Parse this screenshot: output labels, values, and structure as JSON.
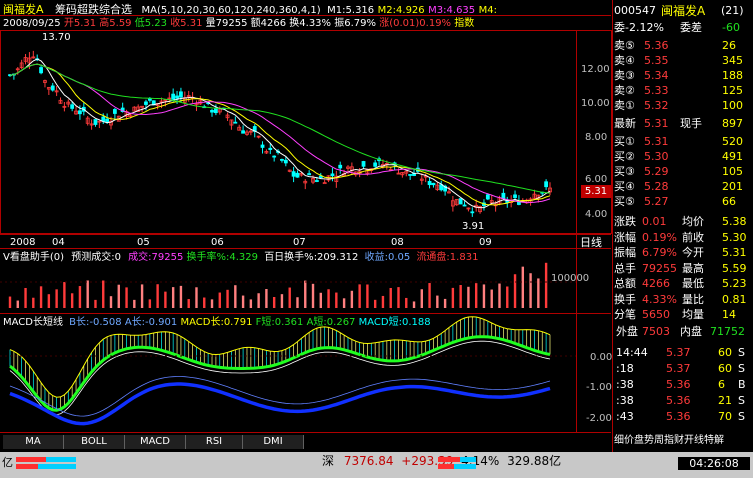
{
  "header": {
    "stock_name": "闽福发A",
    "indicator": "筹码超跌综合选",
    "ma_params": "MA(5,10,20,30,60,120,240,360,4,1)",
    "m1": "M1:5.316",
    "m2": "M2:4.926",
    "m3": "M3:4.635",
    "m4": "M4:",
    "date": "2008/09/25",
    "open": "开5.31",
    "high": "高5.59",
    "low": "低5.23",
    "close": "收5.31",
    "volume": "量79255",
    "amount": "额4266",
    "turnover": "换4.33%",
    "amplitude": "振6.79%",
    "change": "涨(0.01)0.19%",
    "index_label": "指数"
  },
  "price_axis": [
    "12.00",
    "10.00",
    "8.00",
    "6.00",
    "4.00"
  ],
  "peak_label": "13.70",
  "low_label": "3.91",
  "current_price_tag": "5.31",
  "time_axis": [
    "2008",
    "04",
    "05",
    "06",
    "07",
    "08",
    "09"
  ],
  "period_label": "日线",
  "volume_panel": {
    "title": "V看盘助手(0)",
    "forecast": "预测成交:0",
    "deal": "成交:79255",
    "turnover_rate": "换手率%:4.329",
    "hundred_day": "百日换手%:209.312",
    "income": "收益:0.05",
    "float": "流通盘:1.831",
    "axis": "100000"
  },
  "macd_panel": {
    "title": "MACD长短线",
    "b_long": "B长:-0.508",
    "a_long": "A长:-0.901",
    "macd_long": "MACD长:0.791",
    "f_short": "F短:0.361",
    "a_short": "A短:0.267",
    "macd_short": "MACD短:0.188",
    "axis": [
      "0.00",
      "-1.00",
      "-2.00"
    ]
  },
  "tabs": [
    "MA",
    "BOLL",
    "MACD",
    "RSI",
    "DMI"
  ],
  "status_bar": {
    "market": "深",
    "index_value": "7376.84",
    "index_change": "+293.39",
    "index_pct": "4.14%",
    "index_amount": "329.88亿",
    "clock": "04:26:08",
    "left_label": "亿"
  },
  "quote_panel": {
    "code": "000547",
    "name": "闽福发A",
    "count": "(21)",
    "wei_bi": "委-2.12%",
    "wei_cha_label": "委差",
    "wei_cha": "-60",
    "sells": [
      {
        "label": "卖⑤",
        "price": "5.36",
        "vol": "26"
      },
      {
        "label": "卖④",
        "price": "5.35",
        "vol": "345"
      },
      {
        "label": "卖③",
        "price": "5.34",
        "vol": "188"
      },
      {
        "label": "卖②",
        "price": "5.33",
        "vol": "125"
      },
      {
        "label": "卖①",
        "price": "5.32",
        "vol": "100"
      }
    ],
    "latest_label": "最新",
    "latest": "5.31",
    "now_hand_label": "现手",
    "now_hand": "897",
    "buys": [
      {
        "label": "买①",
        "price": "5.31",
        "vol": "520"
      },
      {
        "label": "买②",
        "price": "5.30",
        "vol": "491"
      },
      {
        "label": "买③",
        "price": "5.29",
        "vol": "105"
      },
      {
        "label": "买④",
        "price": "5.28",
        "vol": "201"
      },
      {
        "label": "买⑤",
        "price": "5.27",
        "vol": "66"
      }
    ],
    "stats": [
      {
        "l1": "涨跌",
        "v1": "0.01",
        "l2": "均价",
        "v2": "5.38"
      },
      {
        "l1": "涨幅",
        "v1": "0.19%",
        "l2": "前收",
        "v2": "5.30"
      },
      {
        "l1": "振幅",
        "v1": "6.79%",
        "l2": "今开",
        "v2": "5.31"
      },
      {
        "l1": "总手",
        "v1": "79255",
        "l2": "最高",
        "v2": "5.59"
      },
      {
        "l1": "总额",
        "v1": "4266",
        "l2": "最低",
        "v2": "5.23"
      },
      {
        "l1": "换手",
        "v1": "4.33%",
        "l2": "量比",
        "v2": "0.81"
      },
      {
        "l1": "分笔",
        "v1": "5650",
        "l2": "均量",
        "v2": "14"
      }
    ],
    "outer_label": "外盘",
    "outer": "7503",
    "inner_label": "内盘",
    "inner": "71752",
    "ticks": [
      {
        "time": "14:44",
        "price": "5.37",
        "vol": "60",
        "side": "S"
      },
      {
        "time": ":18",
        "price": "5.37",
        "vol": "60",
        "side": "S"
      },
      {
        "time": ":38",
        "price": "5.36",
        "vol": "6",
        "side": "B"
      },
      {
        "time": ":38",
        "price": "5.36",
        "vol": "21",
        "side": "S"
      },
      {
        "time": ":43",
        "price": "5.36",
        "vol": "70",
        "side": "S"
      }
    ],
    "footer": "细价盘势周指财开线特解"
  },
  "colors": {
    "up": "#ff3b3b",
    "down": "#00ffff",
    "bg": "#000000",
    "grid": "#b00000"
  }
}
